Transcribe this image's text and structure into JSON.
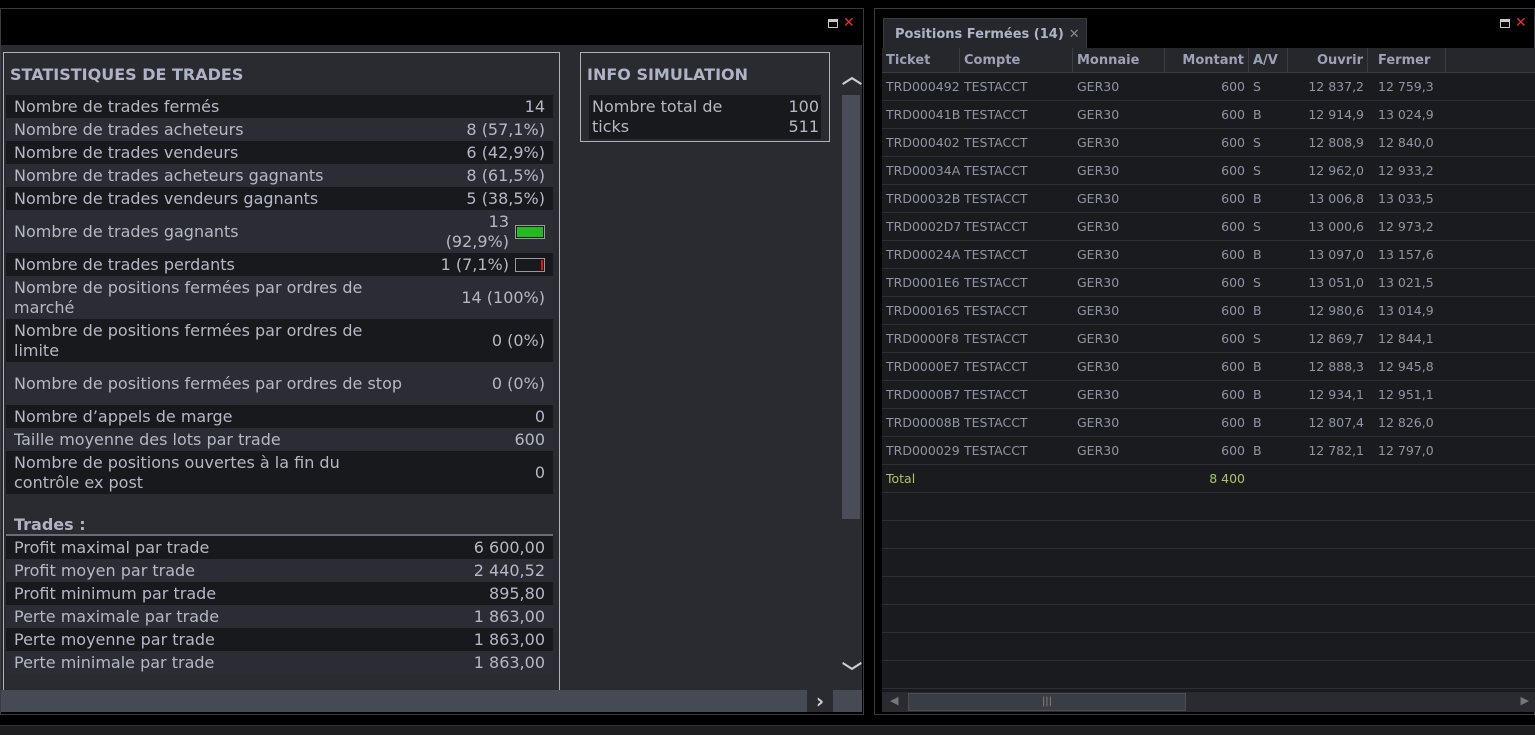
{
  "left_panel": {
    "stats": {
      "title": "STATISTIQUES DE TRADES",
      "rows": [
        {
          "label": "Nombre de trades fermés",
          "value": "14"
        },
        {
          "label": "Nombre de trades acheteurs",
          "value": "8 (57,1%)"
        },
        {
          "label": "Nombre de trades vendeurs",
          "value": "6 (42,9%)"
        },
        {
          "label": "Nombre de trades acheteurs gagnants",
          "value": "8 (61,5%)"
        },
        {
          "label": "Nombre de trades vendeurs gagnants",
          "value": "5 (38,5%)"
        },
        {
          "label": "Nombre de trades gagnants",
          "value": "13 (92,9%)",
          "bar_percent": 92.9,
          "bar_color": "#22bb22"
        },
        {
          "label": "Nombre de trades perdants",
          "value": "1 (7,1%)",
          "bar_percent": 7.1,
          "bar_color": "#ee1111"
        },
        {
          "label": "Nombre de positions fermées par ordres de marché",
          "value": "14 (100%)"
        },
        {
          "label": "Nombre de positions fermées par ordres de limite",
          "value": "0 (0%)"
        },
        {
          "label": "Nombre de positions fermées par ordres de stop",
          "value": "0 (0%)"
        },
        {
          "label": "Nombre d’appels de marge",
          "value": "0"
        },
        {
          "label": "Taille moyenne des lots par trade",
          "value": "600"
        },
        {
          "label": "Nombre de positions ouvertes à la fin du contrôle ex post",
          "value": "0"
        }
      ],
      "trades_heading": "Trades :",
      "trade_rows": [
        {
          "label": "Profit maximal par trade",
          "value": "6 600,00"
        },
        {
          "label": "Profit moyen par trade",
          "value": "2 440,52"
        },
        {
          "label": "Profit minimum par trade",
          "value": "895,80"
        },
        {
          "label": "Perte maximale par trade",
          "value": "1 863,00"
        },
        {
          "label": "Perte moyenne par trade",
          "value": "1 863,00"
        },
        {
          "label": "Perte minimale par trade",
          "value": "1 863,00"
        }
      ]
    },
    "info": {
      "title": "INFO SIMULATION",
      "label": "Nombre total de ticks",
      "value": "100 511"
    }
  },
  "right_panel": {
    "tab_label": "Positions Fermées (14)",
    "columns": [
      "Ticket",
      "Compte",
      "Monnaie",
      "Montant",
      "A/V",
      "Ouvrir",
      "Fermer"
    ],
    "rows": [
      [
        "TRD000492",
        "TESTACCT",
        "GER30",
        "600",
        "S",
        "12 837,2",
        "12 759,3"
      ],
      [
        "TRD00041B",
        "TESTACCT",
        "GER30",
        "600",
        "B",
        "12 914,9",
        "13 024,9"
      ],
      [
        "TRD000402",
        "TESTACCT",
        "GER30",
        "600",
        "S",
        "12 808,9",
        "12 840,0"
      ],
      [
        "TRD00034A",
        "TESTACCT",
        "GER30",
        "600",
        "S",
        "12 962,0",
        "12 933,2"
      ],
      [
        "TRD00032B",
        "TESTACCT",
        "GER30",
        "600",
        "B",
        "13 006,8",
        "13 033,5"
      ],
      [
        "TRD0002D7",
        "TESTACCT",
        "GER30",
        "600",
        "S",
        "13 000,6",
        "12 973,2"
      ],
      [
        "TRD00024A",
        "TESTACCT",
        "GER30",
        "600",
        "B",
        "13 097,0",
        "13 157,6"
      ],
      [
        "TRD0001E6",
        "TESTACCT",
        "GER30",
        "600",
        "S",
        "13 051,0",
        "13 021,5"
      ],
      [
        "TRD000165",
        "TESTACCT",
        "GER30",
        "600",
        "B",
        "12 980,6",
        "13 014,9"
      ],
      [
        "TRD0000F8",
        "TESTACCT",
        "GER30",
        "600",
        "S",
        "12 869,7",
        "12 844,1"
      ],
      [
        "TRD0000E7",
        "TESTACCT",
        "GER30",
        "600",
        "B",
        "12 888,3",
        "12 945,8"
      ],
      [
        "TRD0000B7",
        "TESTACCT",
        "GER30",
        "600",
        "B",
        "12 934,1",
        "12 951,1"
      ],
      [
        "TRD00008B",
        "TESTACCT",
        "GER30",
        "600",
        "B",
        "12 807,4",
        "12 826,0"
      ],
      [
        "TRD000029",
        "TESTACCT",
        "GER30",
        "600",
        "B",
        "12 782,1",
        "12 797,0"
      ]
    ],
    "total_label": "Total",
    "total_amount": "8 400"
  },
  "colors": {
    "accent_close": "#e0352b",
    "total_text": "#a9c46a"
  }
}
